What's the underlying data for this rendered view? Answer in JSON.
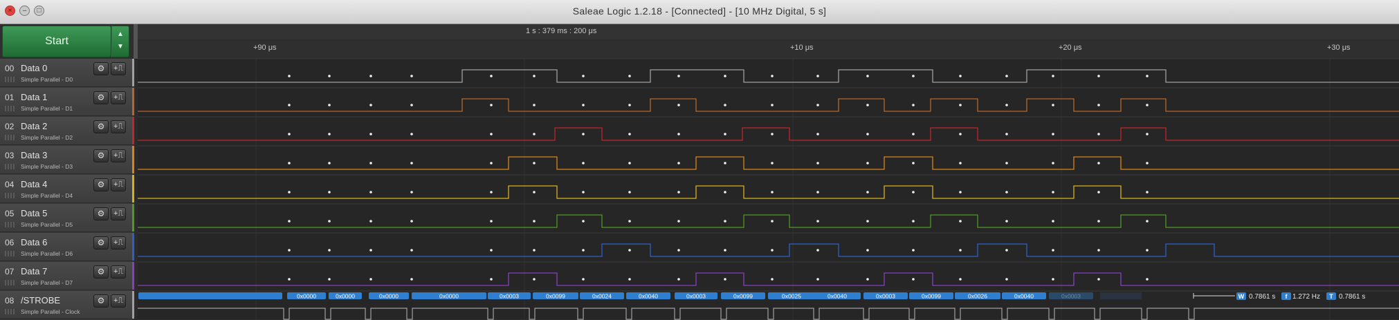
{
  "window": {
    "title": "Saleae Logic 1.2.18 - [Connected] - [10 MHz Digital, 5 s]",
    "close_glyph": "×",
    "min_glyph": "–",
    "max_glyph": "□"
  },
  "start": {
    "label": "Start",
    "up_icon": "▲",
    "down_icon": "▼"
  },
  "ruler": {
    "top_label": "1 s : 379 ms : 200 μs",
    "ticks": [
      "+90 μs",
      "+10 μs",
      "+20 μs",
      "+30 μs"
    ]
  },
  "channels": [
    {
      "num": "00",
      "name": "Data 0",
      "sub": "Simple Parallel - D0",
      "color": "#a0a0a0"
    },
    {
      "num": "01",
      "name": "Data 1",
      "sub": "Simple Parallel - D1",
      "color": "#b8662a"
    },
    {
      "num": "02",
      "name": "Data 2",
      "sub": "Simple Parallel - D2",
      "color": "#c0262b"
    },
    {
      "num": "03",
      "name": "Data 3",
      "sub": "Simple Parallel - D3",
      "color": "#d9841a"
    },
    {
      "num": "04",
      "name": "Data 4",
      "sub": "Simple Parallel - D4",
      "color": "#d6b21a"
    },
    {
      "num": "05",
      "name": "Data 5",
      "sub": "Simple Parallel - D5",
      "color": "#4d9a25"
    },
    {
      "num": "06",
      "name": "Data 6",
      "sub": "Simple Parallel - D6",
      "color": "#2f5fc8"
    },
    {
      "num": "07",
      "name": "Data 7",
      "sub": "Simple Parallel - D7",
      "color": "#8a3fc0"
    },
    {
      "num": "08",
      "name": "/STROBE",
      "sub": "Simple Parallel - Clock",
      "color": "#a0a0a0"
    }
  ],
  "channel_buttons": {
    "gear_icon": "⚙",
    "trigger_icon": "+⎍"
  },
  "decoded_values": [
    "0x0000",
    "0x0000",
    "0x0000",
    "0x0000",
    "0x0003",
    "0x0099",
    "0x0024",
    "0x0040",
    "0x0003",
    "0x0099",
    "0x0025",
    "0x0040",
    "0x0003",
    "0x0099",
    "0x0026",
    "0x0040",
    "0x0003"
  ],
  "measurements": {
    "w_label": "W",
    "w_value": "0.7861 s",
    "f_label": "f",
    "f_value": "1.272 Hz",
    "t_label": "T",
    "t_value": "0.7861 s"
  },
  "colors": {
    "decode_bubble": "#2f7fd0",
    "trace_bg": "#2b2b2b"
  }
}
